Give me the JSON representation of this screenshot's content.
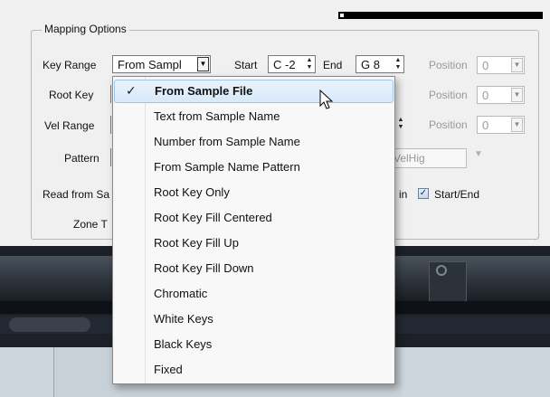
{
  "dialog": {
    "group_title": "Mapping Options",
    "key_range": {
      "label": "Key Range",
      "value": "From Sampl",
      "start_label": "Start",
      "start_value": "C -2",
      "end_label": "End",
      "end_value": "G 8"
    },
    "root_key": {
      "label": "Root Key"
    },
    "vel_range": {
      "label": "Vel Range"
    },
    "pattern": {
      "label": "Pattern",
      "value": "ow)-$(VelHig"
    },
    "read_from": {
      "label": "Read from Sa"
    },
    "zone": {
      "label": "Zone T"
    },
    "domain": {
      "label": "in"
    },
    "start_end": {
      "label": "Start/End",
      "checked": true
    },
    "positions": [
      {
        "label": "Position",
        "value": "0"
      },
      {
        "label": "Position",
        "value": "0"
      },
      {
        "label": "Position",
        "value": "0"
      }
    ],
    "progress_fraction": 0.02
  },
  "dropdown": {
    "selected_index": 0,
    "items": [
      "From Sample File",
      "Text from Sample Name",
      "Number from Sample Name",
      "From Sample Name Pattern",
      "Root Key Only",
      "Root Key Fill Centered",
      "Root Key Fill Up",
      "Root Key Fill Down",
      "Chromatic",
      "White Keys",
      "Black Keys",
      "Fixed"
    ]
  },
  "icons": {
    "check": "checkmark-icon",
    "cursor": "mouse-pointer-icon",
    "combo": "chevron-down-icon",
    "spin": "spin-updown-icon"
  },
  "colors": {
    "selection_bg": "#d8e9fb",
    "selection_border": "#9ec4ee",
    "dialog_bg": "#f0f0f0"
  }
}
